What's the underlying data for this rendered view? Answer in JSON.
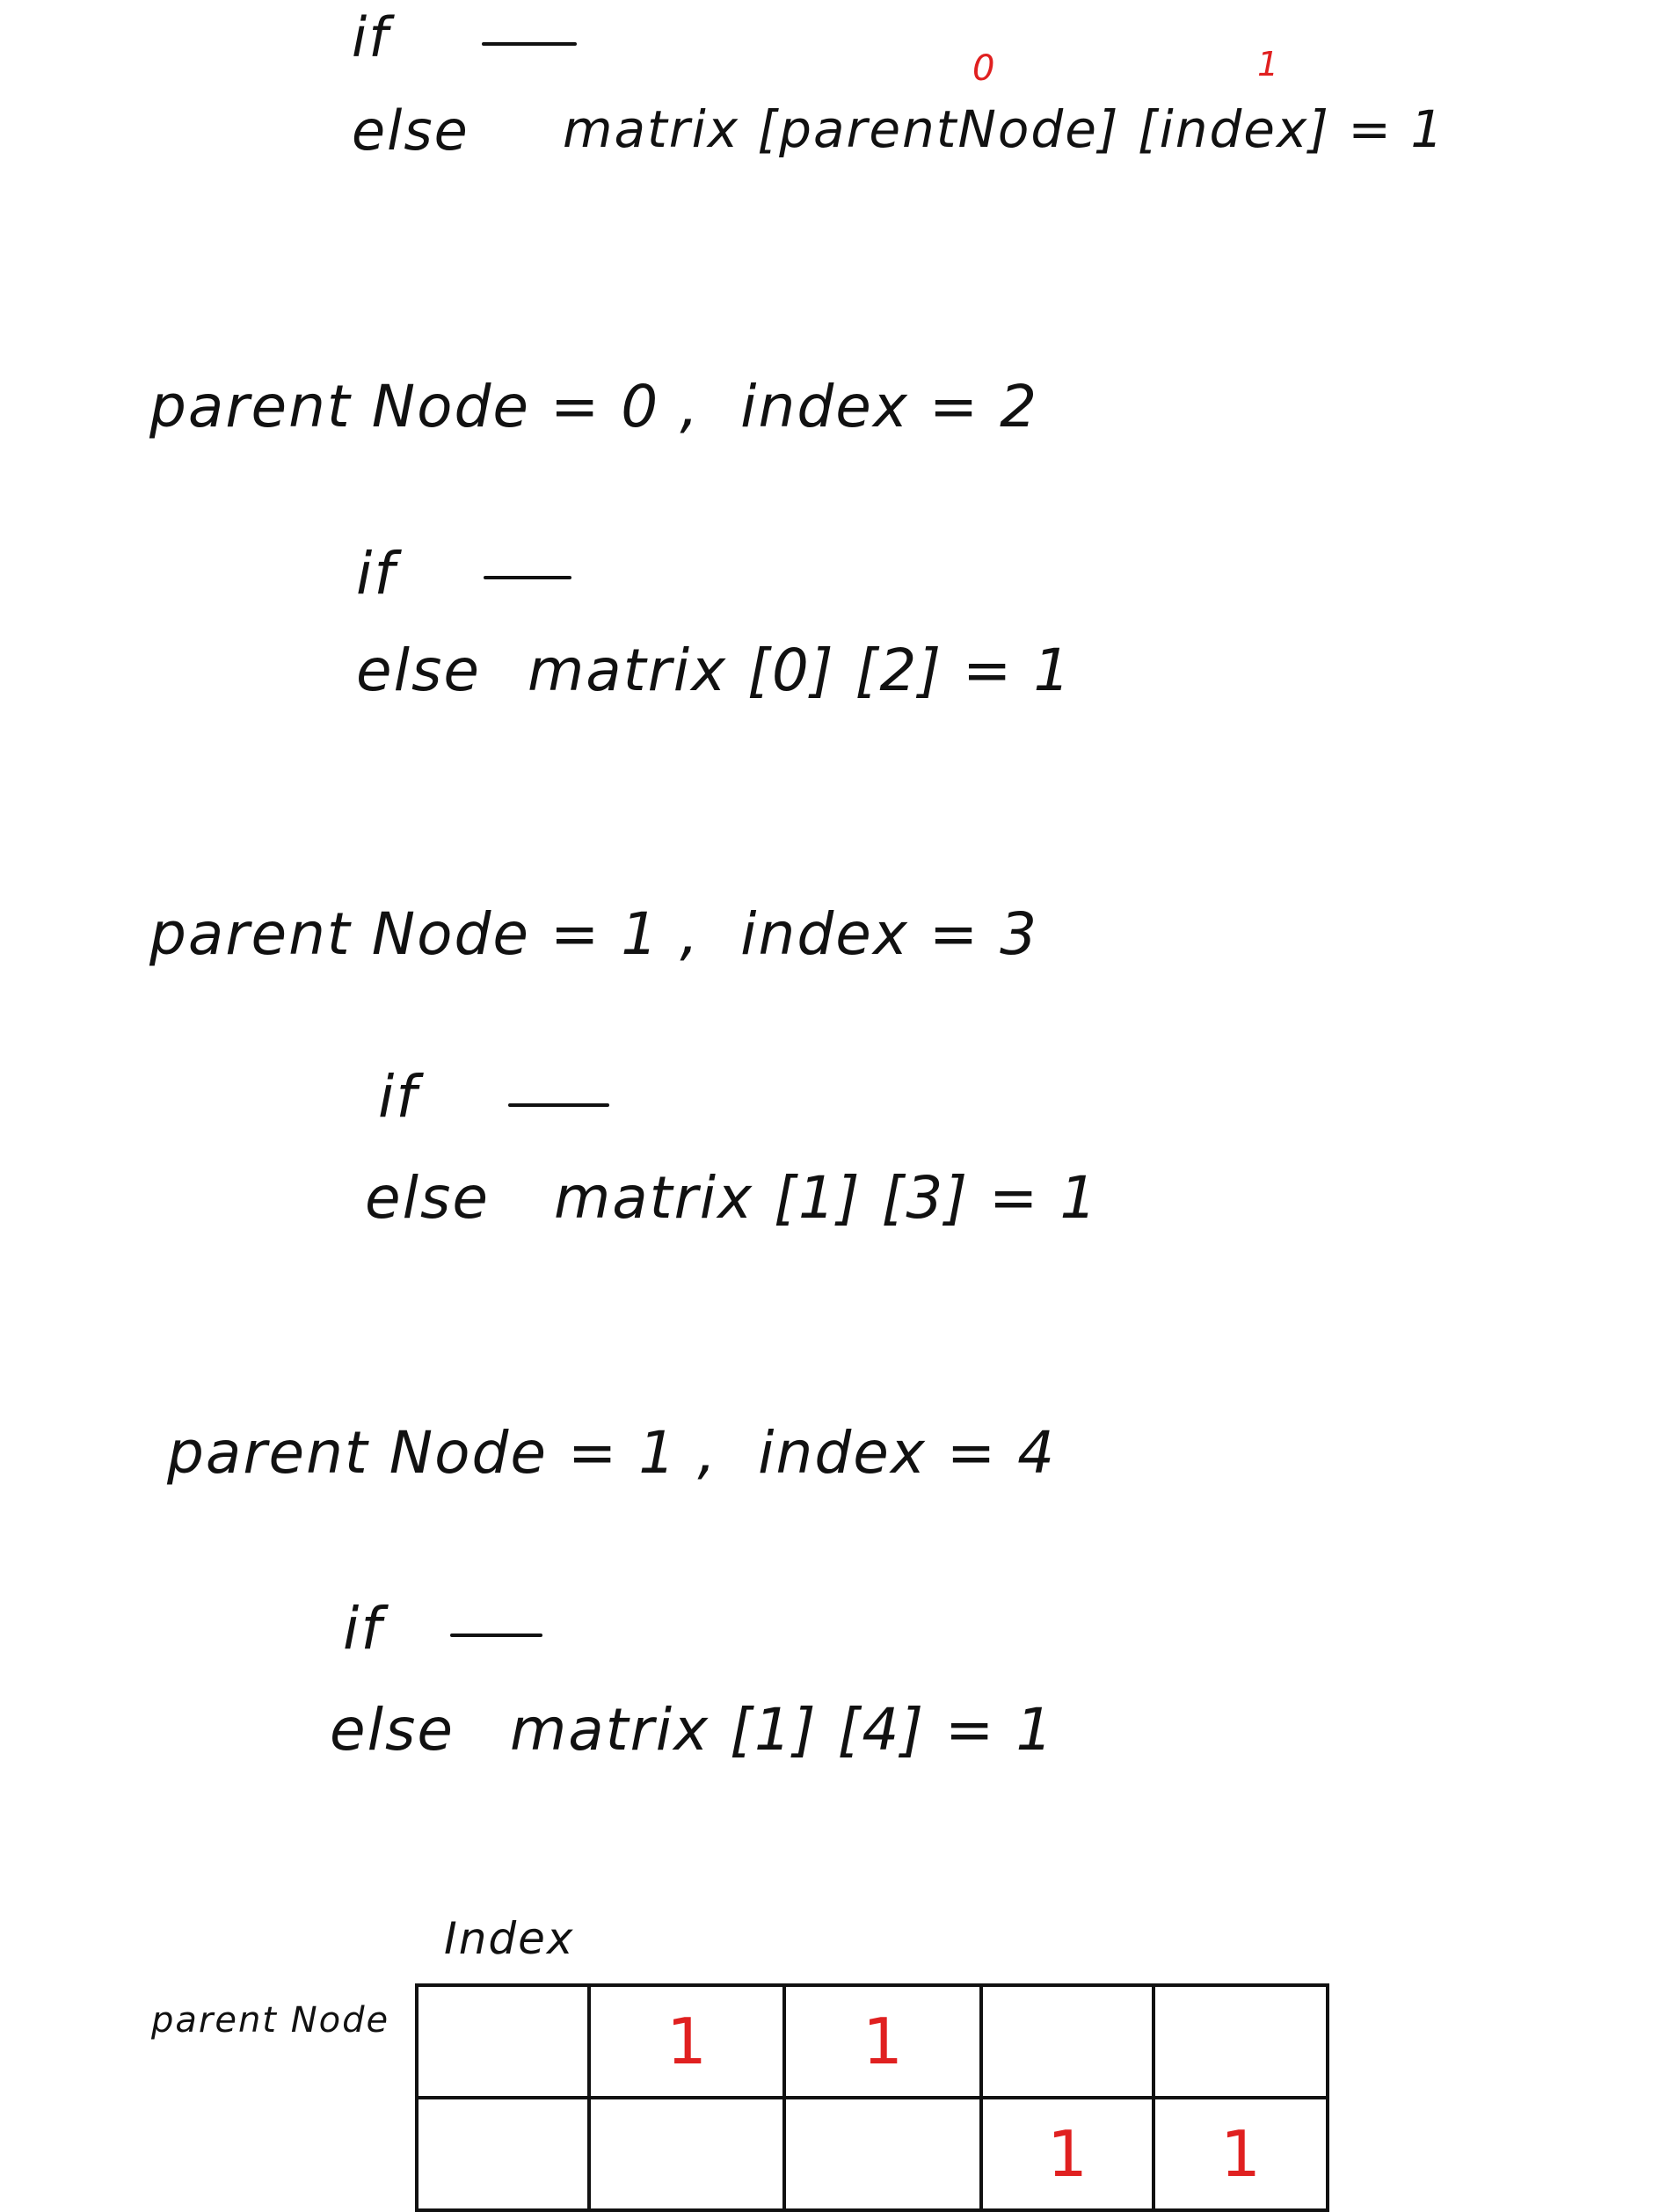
{
  "block1": {
    "if_text": "if",
    "else_text": "else",
    "expr": "matrix [parentNode] [index] = 1",
    "annot_parent": "0",
    "annot_index": "1"
  },
  "step1": {
    "header": "parent Node = 0 ,  index = 2",
    "if_text": "if",
    "else_text": "else",
    "expr": "matrix [0] [2] = 1"
  },
  "step2": {
    "header": "parent Node = 1 ,  index = 3",
    "if_text": "if",
    "else_text": "else",
    "expr": "matrix [1] [3] = 1"
  },
  "step3": {
    "header": "parent Node = 1 ,  index = 4",
    "if_text": "if",
    "else_text": "else",
    "expr": "matrix [1] [4] = 1"
  },
  "table": {
    "col_label": "Index",
    "row_label": "parent Node",
    "rows": [
      [
        "",
        "1",
        "1",
        "",
        ""
      ],
      [
        "",
        "",
        "",
        "1",
        "1"
      ]
    ]
  },
  "colors": {
    "ink": "#111111",
    "red": "#e02020"
  }
}
